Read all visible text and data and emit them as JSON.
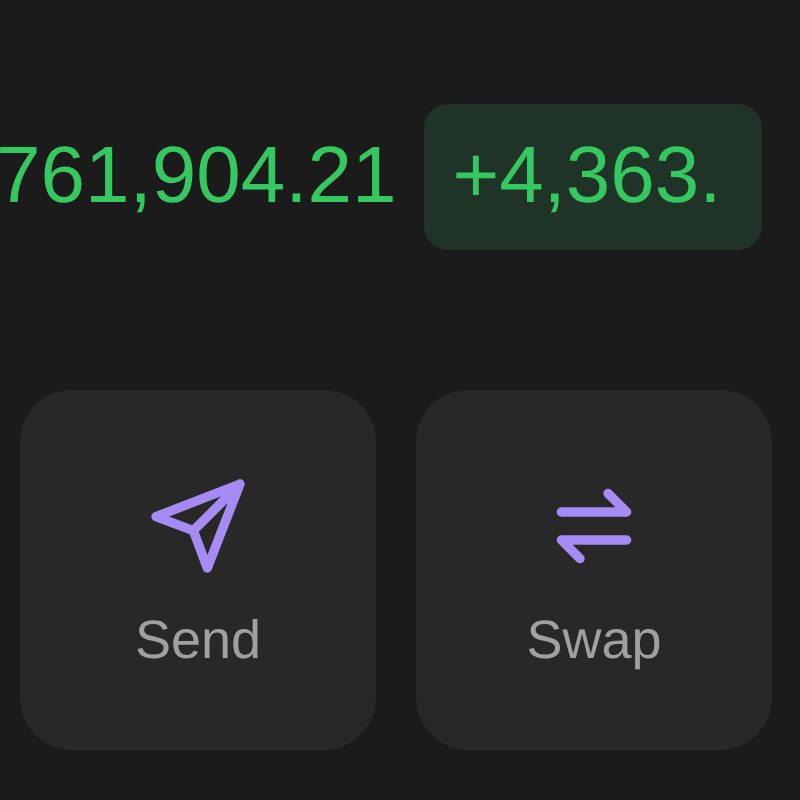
{
  "balance": {
    "amount": "761,904.21",
    "change": "+4,363."
  },
  "actions": [
    {
      "kind": "send",
      "label": "Send"
    },
    {
      "kind": "swap",
      "label": "Swap"
    }
  ]
}
